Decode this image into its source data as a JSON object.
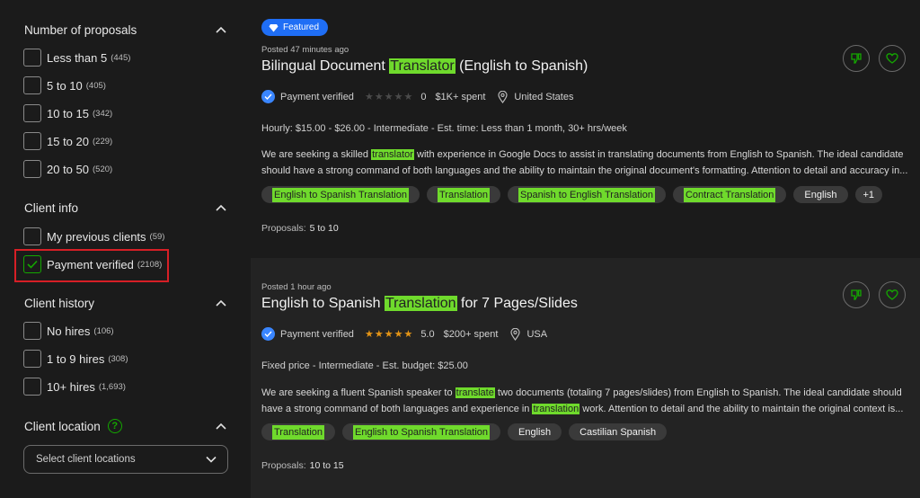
{
  "filters": {
    "proposals": {
      "title": "Number of proposals",
      "options": [
        {
          "label": "Less than 5",
          "count": "(445)"
        },
        {
          "label": "5 to 10",
          "count": "(405)"
        },
        {
          "label": "10 to 15",
          "count": "(342)"
        },
        {
          "label": "15 to 20",
          "count": "(229)"
        },
        {
          "label": "20 to 50",
          "count": "(520)"
        }
      ]
    },
    "client_info": {
      "title": "Client info",
      "options": [
        {
          "label": "My previous clients",
          "count": "(59)",
          "checked": false
        },
        {
          "label": "Payment verified",
          "count": "(2108)",
          "checked": true
        }
      ]
    },
    "client_history": {
      "title": "Client history",
      "options": [
        {
          "label": "No hires",
          "count": "(106)"
        },
        {
          "label": "1 to 9 hires",
          "count": "(308)"
        },
        {
          "label": "10+ hires",
          "count": "(1,693)"
        }
      ]
    },
    "client_location": {
      "title": "Client location",
      "help_icon": "?",
      "select_placeholder": "Select client locations"
    }
  },
  "jobs": [
    {
      "featured_label": "Featured",
      "posted": "Posted 47 minutes ago",
      "title_before": "Bilingual Document ",
      "title_highlight": "Translator",
      "title_after": " (English to Spanish)",
      "payment": "Payment verified",
      "rating": "0",
      "stars_filled": 0,
      "spent": "$1K+ spent",
      "location": "United States",
      "terms": "Hourly: $15.00 - $26.00 - Intermediate - Est. time: Less than 1 month, 30+ hrs/week",
      "desc_line1_a": "We are seeking a skilled ",
      "desc_line1_hl": "translator",
      "desc_line1_b": " with experience in Google Docs to assist in translating documents from English to Spanish. The ideal candidate",
      "desc_line2": "should have a strong command of both languages and the ability to maintain the original document's formatting. Attention to detail and accuracy in...",
      "tags": [
        {
          "label": "English to Spanish Translation",
          "hl": true
        },
        {
          "label": "Translation",
          "hl": true
        },
        {
          "label": "Spanish to English Translation",
          "hl": true
        },
        {
          "label": "Contract Translation",
          "hl": true
        },
        {
          "label": "English",
          "hl": false
        }
      ],
      "more_tags": "+1",
      "proposals_label": "Proposals:",
      "proposals_value": "5 to 10"
    },
    {
      "posted": "Posted 1 hour ago",
      "title_before": "English to Spanish ",
      "title_highlight": "Translation",
      "title_after": " for 7 Pages/Slides",
      "payment": "Payment verified",
      "rating": "5.0",
      "stars_filled": 5,
      "spent": "$200+ spent",
      "location": "USA",
      "terms": "Fixed price - Intermediate - Est. budget: $25.00",
      "desc_line1_a": "We are seeking a fluent Spanish speaker to ",
      "desc_line1_hl": "translate",
      "desc_line1_b": " two documents (totaling 7 pages/slides) from English to Spanish. The ideal candidate should",
      "desc_line2_a": "have a strong command of both languages and experience in ",
      "desc_line2_hl": "translation",
      "desc_line2_b": " work. Attention to detail and the ability to maintain the original context is...",
      "tags": [
        {
          "label": "Translation",
          "hl": true
        },
        {
          "label": "English to Spanish Translation",
          "hl": true
        },
        {
          "label": "English",
          "hl": false
        },
        {
          "label": "Castilian Spanish",
          "hl": false
        }
      ],
      "proposals_label": "Proposals:",
      "proposals_value": "10 to 15"
    }
  ],
  "colors": {
    "highlight": "#6fda2c",
    "accent_green": "#14a800",
    "featured_blue": "#1f6ef5",
    "annotation_red": "#d61f26",
    "star": "#e39416"
  }
}
